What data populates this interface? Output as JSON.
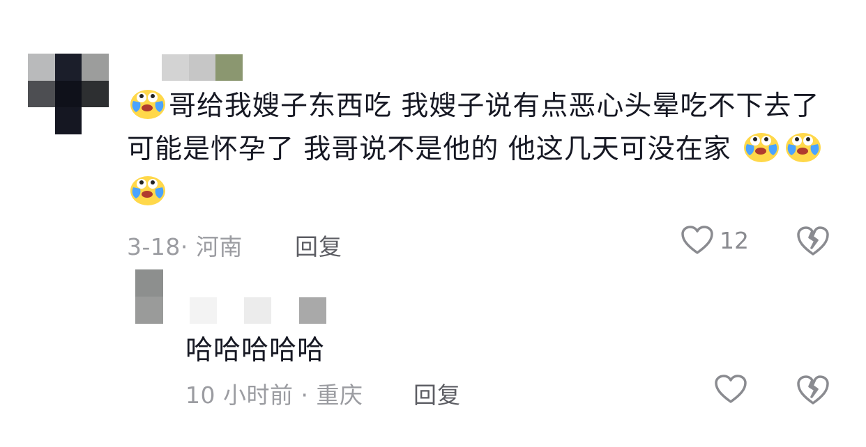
{
  "main_comment": {
    "text_before_emoji": "哥给我嫂子东西吃  我嫂子说有点恶心头晕吃不下去了 可能是怀孕了  我哥说不是他的  他这几天可没在家  ",
    "date_location": "3-18· 河南",
    "reply_label": "回复",
    "like_count": "12",
    "leading_emoji": "crying-laughing-emoji",
    "trailing_emojis": [
      "crying-laughing-emoji",
      "crying-laughing-emoji",
      "crying-laughing-emoji"
    ]
  },
  "reply_comment": {
    "text": "哈哈哈哈哈",
    "time_location": "10 小时前 · 重庆",
    "reply_label": "回复"
  },
  "icons": {
    "like": "heart-outline-icon",
    "dislike": "broken-heart-icon"
  },
  "colors": {
    "text_primary": "#161823",
    "text_meta": "#9b9ca1",
    "icon_gray": "#8a8b90",
    "emoji_yellow": "#ffd84a",
    "emoji_tear": "#4aa3ff"
  }
}
